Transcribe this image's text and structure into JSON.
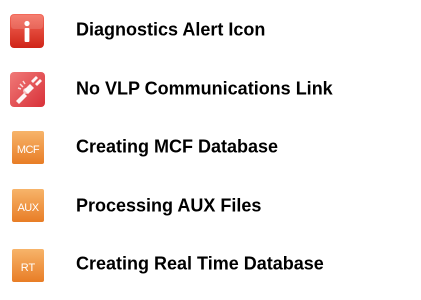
{
  "legend": {
    "items": [
      {
        "label": "Diagnostics Alert Icon",
        "icon": "diagnostics-alert-icon",
        "color": "#e53a2f"
      },
      {
        "label": "No VLP Communications Link",
        "icon": "no-link-icon",
        "color": "#e64a4f"
      },
      {
        "label": "Creating MCF Database",
        "icon": "mcf-database-icon",
        "icon_text": "MCF",
        "color": "#f08f3a"
      },
      {
        "label": "Processing AUX Files",
        "icon": "aux-files-icon",
        "icon_text": "AUX",
        "color": "#f08f3a"
      },
      {
        "label": "Creating Real Time Database",
        "icon": "real-time-database-icon",
        "icon_text": "RT",
        "color": "#f08f3a"
      }
    ]
  }
}
